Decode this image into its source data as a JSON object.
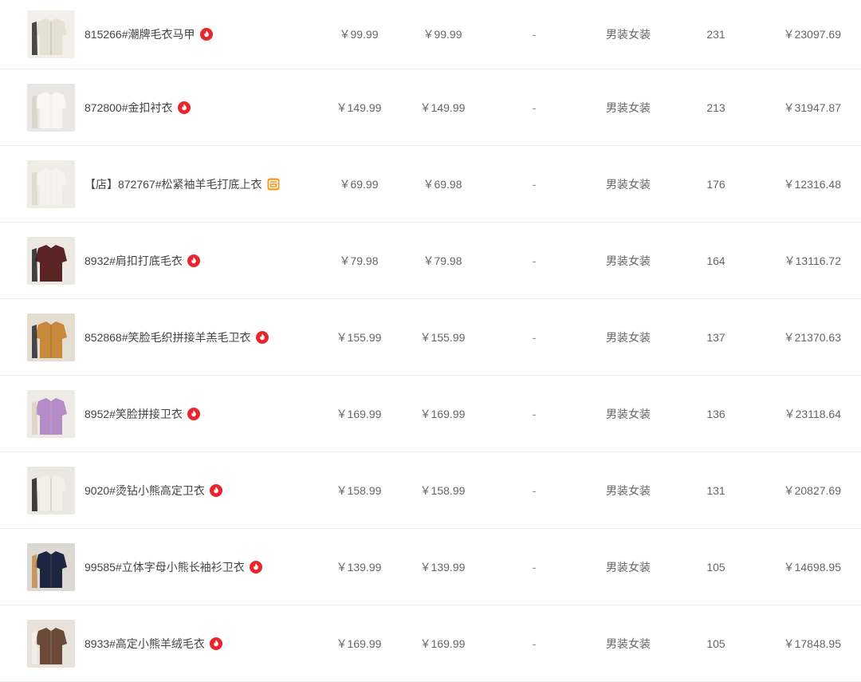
{
  "rows": [
    {
      "name": "815266#潮牌毛衣马甲",
      "badge": "hot",
      "price1": "￥99.99",
      "price2": "￥99.99",
      "dash": "-",
      "category": "男装女装",
      "qty": "231",
      "total": "￥23097.69"
    },
    {
      "name": "872800#金扣衬衣",
      "badge": "hot",
      "price1": "￥149.99",
      "price2": "￥149.99",
      "dash": "-",
      "category": "男装女装",
      "qty": "213",
      "total": "￥31947.87"
    },
    {
      "name": "【店】872767#松紧袖羊毛打底上衣",
      "badge": "store",
      "price1": "￥69.99",
      "price2": "￥69.98",
      "dash": "-",
      "category": "男装女装",
      "qty": "176",
      "total": "￥12316.48"
    },
    {
      "name": "8932#肩扣打底毛衣",
      "badge": "hot",
      "price1": "￥79.98",
      "price2": "￥79.98",
      "dash": "-",
      "category": "男装女装",
      "qty": "164",
      "total": "￥13116.72"
    },
    {
      "name": "852868#笑脸毛织拼接羊羔毛卫衣",
      "badge": "hot",
      "price1": "￥155.99",
      "price2": "￥155.99",
      "dash": "-",
      "category": "男装女装",
      "qty": "137",
      "total": "￥21370.63"
    },
    {
      "name": "8952#笑脸拼接卫衣",
      "badge": "hot",
      "price1": "￥169.99",
      "price2": "￥169.99",
      "dash": "-",
      "category": "男装女装",
      "qty": "136",
      "total": "￥23118.64"
    },
    {
      "name": "9020#烫钻小熊高定卫衣",
      "badge": "hot",
      "price1": "￥158.99",
      "price2": "￥158.99",
      "dash": "-",
      "category": "男装女装",
      "qty": "131",
      "total": "￥20827.69"
    },
    {
      "name": "99585#立体字母小熊长袖衫卫衣",
      "badge": "hot",
      "price1": "￥139.99",
      "price2": "￥139.99",
      "dash": "-",
      "category": "男装女装",
      "qty": "105",
      "total": "￥14698.95"
    },
    {
      "name": "8933#高定小熊羊绒毛衣",
      "badge": "hot",
      "price1": "￥169.99",
      "price2": "￥169.99",
      "dash": "-",
      "category": "男装女装",
      "qty": "105",
      "total": "￥17848.95"
    }
  ],
  "colors": {
    "hot_badge": "#e8262b",
    "store_badge": "#f39a1e",
    "divider": "#ececec",
    "text": "#555555"
  },
  "thumb_palettes": [
    [
      "#f2efe9",
      "#e6dfd3",
      "#2b2b2b"
    ],
    [
      "#e9e7e3",
      "#f7f6f3",
      "#d6d2cb"
    ],
    [
      "#efece5",
      "#f6f3ec",
      "#ddd8ce"
    ],
    [
      "#ece9e4",
      "#5a2424",
      "#222222"
    ],
    [
      "#e4ddd2",
      "#c88a3a",
      "#2a2a2a"
    ],
    [
      "#eeeae6",
      "#b48cc8",
      "#d8d2c6"
    ],
    [
      "#ebe8e3",
      "#f3efe6",
      "#1f1f1f"
    ],
    [
      "#dcd9d4",
      "#1c2640",
      "#c48a4a"
    ],
    [
      "#e7e2da",
      "#6b4a3a",
      "#f2efe9"
    ]
  ]
}
